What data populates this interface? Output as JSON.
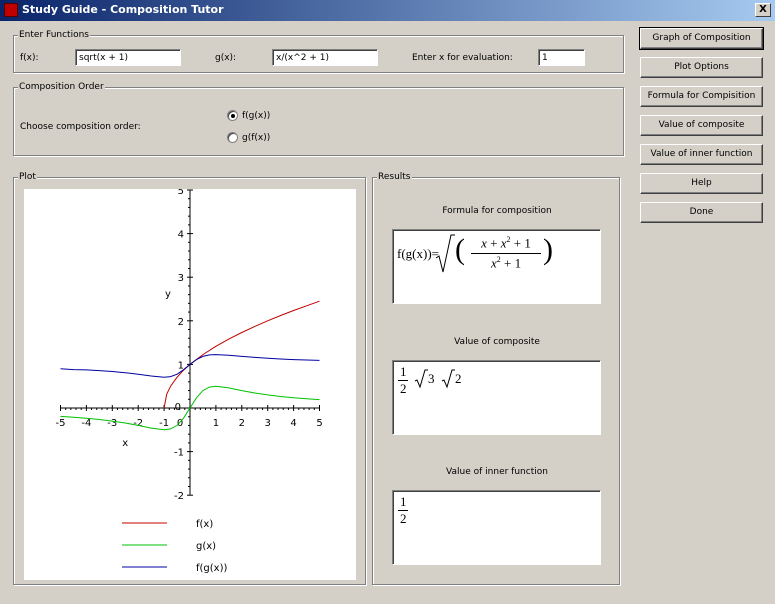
{
  "window": {
    "title": "Study Guide - Composition Tutor",
    "close_glyph": "X"
  },
  "enter_functions": {
    "legend": "Enter Functions",
    "f_label": "f(x):",
    "f_value": "sqrt(x + 1)",
    "g_label": "g(x):",
    "g_value": "x/(x^2 + 1)",
    "x_label": "Enter x for evaluation:",
    "x_value": "1"
  },
  "composition_order": {
    "legend": "Composition Order",
    "prompt": "Choose composition order:",
    "options": [
      "f(g(x))",
      "g(f(x))"
    ],
    "selected": "f(g(x))"
  },
  "buttons": [
    "Graph of Composition",
    "Plot Options",
    "Formula for Compisition",
    "Value of composite",
    "Value of inner function",
    "Help",
    "Done"
  ],
  "plot": {
    "legend": "Plot"
  },
  "results": {
    "legend": "Results",
    "formula_label": "Formula for composition",
    "composite_label": "Value of composite",
    "inner_label": "Value of inner function",
    "formula_lhs": "f(g(x))=",
    "formula_num_a": "x",
    "formula_num_plus1": "+",
    "formula_num_b": "x",
    "formula_num_b_exp": "2",
    "formula_num_plus2": "+",
    "formula_num_c": "1",
    "formula_den_a": "x",
    "formula_den_exp": "2",
    "formula_den_plus": "+",
    "formula_den_c": "1",
    "composite_num": "1",
    "composite_den": "2",
    "composite_root1": "3",
    "composite_root2": "2",
    "inner_num": "1",
    "inner_den": "2"
  },
  "chart_data": {
    "type": "line",
    "xlabel": "x",
    "ylabel": "y",
    "xlim": [
      -5,
      5
    ],
    "ylim": [
      -2,
      5
    ],
    "xticks": [
      -5,
      -4,
      -3,
      -2,
      -1,
      0,
      1,
      2,
      3,
      4,
      5
    ],
    "yticks": [
      -2,
      -1,
      0,
      1,
      2,
      3,
      4,
      5
    ],
    "legend_position": "bottom",
    "series": [
      {
        "name": "f(x)",
        "color": "#c00000",
        "x": [
          -1,
          -0.9,
          -0.75,
          -0.5,
          -0.25,
          0,
          0.5,
          1,
          1.5,
          2,
          2.5,
          3,
          3.5,
          4,
          4.5,
          5
        ],
        "y": [
          0,
          0.316,
          0.5,
          0.707,
          0.866,
          1,
          1.225,
          1.414,
          1.581,
          1.732,
          1.871,
          2,
          2.121,
          2.236,
          2.345,
          2.449
        ]
      },
      {
        "name": "g(x)",
        "color": "#00c000",
        "x": [
          -5,
          -4.5,
          -4,
          -3.5,
          -3,
          -2.5,
          -2,
          -1.5,
          -1,
          -0.75,
          -0.5,
          -0.25,
          0,
          0.25,
          0.5,
          0.75,
          1,
          1.5,
          2,
          2.5,
          3,
          3.5,
          4,
          4.5,
          5
        ],
        "y": [
          -0.192,
          -0.212,
          -0.235,
          -0.264,
          -0.3,
          -0.345,
          -0.4,
          -0.462,
          -0.5,
          -0.48,
          -0.4,
          -0.235,
          0,
          0.235,
          0.4,
          0.48,
          0.5,
          0.462,
          0.4,
          0.345,
          0.3,
          0.264,
          0.235,
          0.212,
          0.192
        ]
      },
      {
        "name": "f(g(x))",
        "color": "#0000a0",
        "x": [
          -5,
          -4.5,
          -4,
          -3.5,
          -3,
          -2.5,
          -2,
          -1.5,
          -1,
          -0.75,
          -0.5,
          -0.25,
          0,
          0.25,
          0.5,
          0.75,
          1,
          1.5,
          2,
          2.5,
          3,
          3.5,
          4,
          4.5,
          5
        ],
        "y": [
          0.899,
          0.88,
          0.874,
          0.858,
          0.837,
          0.81,
          0.775,
          0.733,
          0.707,
          0.721,
          0.775,
          0.875,
          1,
          1.111,
          1.183,
          1.217,
          1.225,
          1.209,
          1.183,
          1.16,
          1.14,
          1.124,
          1.111,
          1.1,
          1.092
        ]
      }
    ]
  }
}
